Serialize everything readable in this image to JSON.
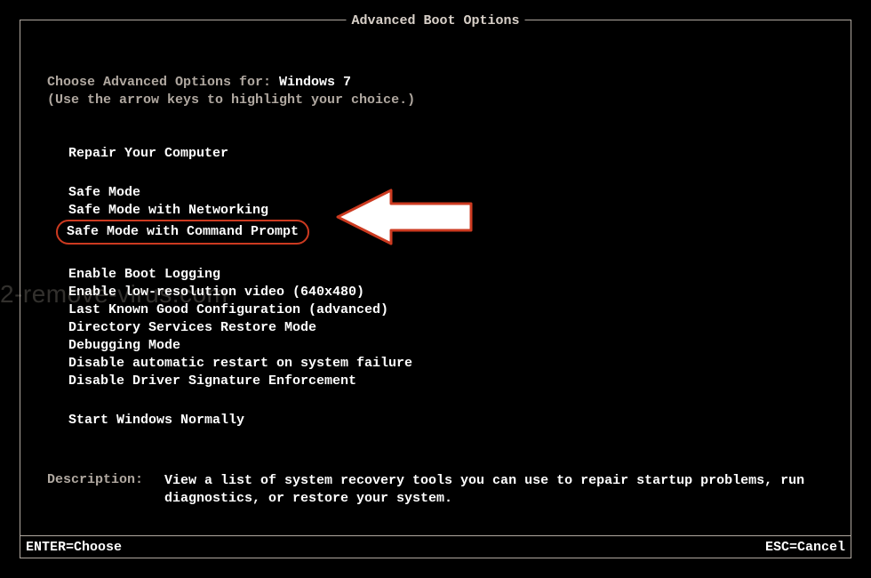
{
  "title": "Advanced Boot Options",
  "subtitle_label": "Choose Advanced Options for: ",
  "os_name": "Windows 7",
  "hint": "(Use the arrow keys to highlight your choice.)",
  "menu": {
    "group1": [
      "Repair Your Computer"
    ],
    "group2": [
      "Safe Mode",
      "Safe Mode with Networking",
      "Safe Mode with Command Prompt"
    ],
    "group3": [
      "Enable Boot Logging",
      "Enable low-resolution video (640x480)",
      "Last Known Good Configuration (advanced)",
      "Directory Services Restore Mode",
      "Debugging Mode",
      "Disable automatic restart on system failure",
      "Disable Driver Signature Enforcement"
    ],
    "group4": [
      "Start Windows Normally"
    ]
  },
  "highlighted_item": "Safe Mode with Command Prompt",
  "description_label": "Description:",
  "description_text": "View a list of system recovery tools you can use to repair startup problems, run diagnostics, or restore your system.",
  "footer": {
    "left": "ENTER=Choose",
    "right": "ESC=Cancel"
  },
  "watermark": "2-remove-virus.com"
}
